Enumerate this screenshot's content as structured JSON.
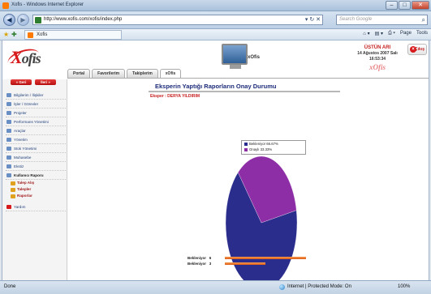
{
  "browser": {
    "window_title": "Xofis - Windows Internet Explorer",
    "url": "http://www.xofis.com/xofis/index.php",
    "search_placeholder": "Search Google",
    "tab_title": "Xofis",
    "page_menu": "Page",
    "tools_menu": "Tools",
    "status_left": "Done",
    "status_zone": "Internet | Protected Mode: On",
    "zoom": "100%"
  },
  "header": {
    "logo_x": "X",
    "logo_rest": "ofis",
    "monitor_label": "xOfis",
    "user_name": "ÜSTÜN ARI",
    "date": "14 Ağustos 2007 Salı",
    "time": "16:53:34",
    "brand": "xOfis",
    "exit_label": "Çıkış"
  },
  "tabs": [
    {
      "label": "Portal"
    },
    {
      "label": "Favorilerim"
    },
    {
      "label": "Takiplerim"
    },
    {
      "label": "xOfis"
    }
  ],
  "sidebar": {
    "back_label": "« Geri",
    "next_label": "İleri »",
    "items": [
      {
        "label": "Bilgilerim / İlişkiler"
      },
      {
        "label": "İşler / Görevler"
      },
      {
        "label": "Projeler"
      },
      {
        "label": "Performans Yönetimi"
      },
      {
        "label": "Araçlar"
      },
      {
        "label": "Yönetim"
      },
      {
        "label": "Stok Yönetimi"
      },
      {
        "label": "Muhasebe"
      },
      {
        "label": "Ekstiz"
      },
      {
        "label": "Kullanıcı Raporu"
      },
      {
        "label": "Talep Alış"
      },
      {
        "label": "Talepler"
      },
      {
        "label": "Raporlar"
      },
      {
        "label": "Yardım"
      }
    ]
  },
  "report": {
    "title": "Eksperin Yaptığı Raporların Onay Durumu",
    "expert": "Eksper : DERYA YILDIRIM",
    "bar_rows": [
      {
        "label": "Bekleniyor",
        "value": "6"
      },
      {
        "label": "Bekleniyor",
        "value": "3"
      }
    ]
  },
  "chart_data": {
    "type": "pie",
    "title": "",
    "series": [
      {
        "name": "Bekleniyor 66.67%",
        "value": 66.67,
        "color": "#2b2d8c"
      },
      {
        "name": "Onaylı 33.33%",
        "value": 33.33,
        "color": "#8e2ea6"
      }
    ],
    "legend_position": "top-right",
    "bars": [
      {
        "label": "Bekleniyor",
        "value": 6,
        "color": "#e8702a"
      },
      {
        "label": "Bekleniyor",
        "value": 3,
        "color": "#e8702a"
      }
    ]
  }
}
